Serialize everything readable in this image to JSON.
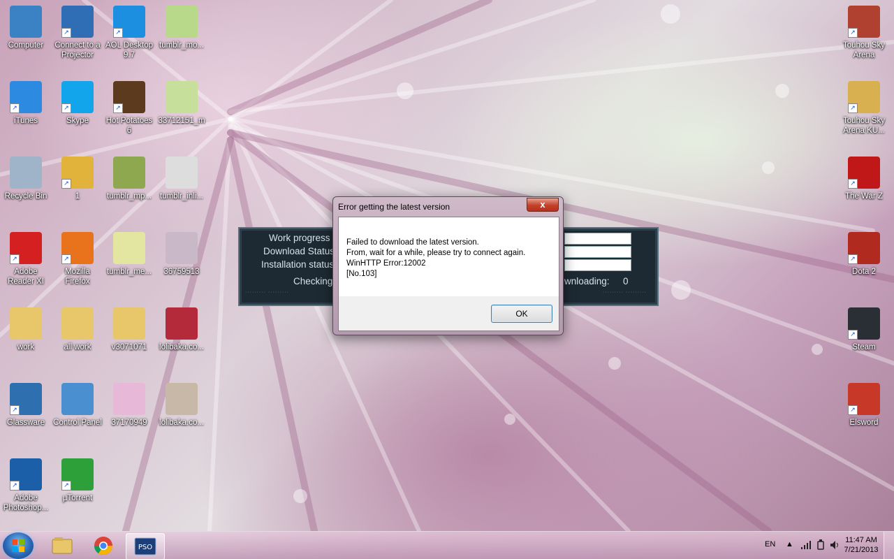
{
  "desktop_left": [
    {
      "label": "Computer",
      "icon": "computer-icon",
      "color": "#3b82c4"
    },
    {
      "label": "Connect to a Projector",
      "icon": "projector-icon",
      "color": "#2f6eb5"
    },
    {
      "label": "AOL Desktop 9.7",
      "icon": "aol-icon",
      "color": "#1d8fe0"
    },
    {
      "label": "tumblr_mo...",
      "icon": "image-thumbnail-icon",
      "color": "#b8d88a"
    },
    {
      "label": "iTunes",
      "icon": "itunes-icon",
      "color": "#2c8be0"
    },
    {
      "label": "Skype",
      "icon": "skype-icon",
      "color": "#12a5ec"
    },
    {
      "label": "Hot Potatoes 6",
      "icon": "hot-potatoes-icon",
      "color": "#5b3a1e"
    },
    {
      "label": "33712151_m",
      "icon": "image-thumbnail-icon",
      "color": "#c6e09c"
    },
    {
      "label": "Recycle Bin",
      "icon": "recycle-bin-icon",
      "color": "#9fb4c8"
    },
    {
      "label": "1",
      "icon": "chrome-icon",
      "color": "#e2b33a"
    },
    {
      "label": "tumblr_mp...",
      "icon": "image-thumbnail-icon",
      "color": "#8ea850"
    },
    {
      "label": "tumblr_inli...",
      "icon": "image-thumbnail-icon",
      "color": "#dddddd"
    },
    {
      "label": "Adobe Reader XI",
      "icon": "adobe-reader-icon",
      "color": "#d42020"
    },
    {
      "label": "Mozilla Firefox",
      "icon": "firefox-icon",
      "color": "#e8731c"
    },
    {
      "label": "tumblr_me...",
      "icon": "image-thumbnail-icon",
      "color": "#e2e6a0"
    },
    {
      "label": "36759513",
      "icon": "image-thumbnail-icon",
      "color": "#c8b8c8"
    },
    {
      "label": "work",
      "icon": "folder-icon",
      "color": "#e8c66a"
    },
    {
      "label": "all work",
      "icon": "folder-icon",
      "color": "#e8c66a"
    },
    {
      "label": "v3071071",
      "icon": "folder-icon",
      "color": "#e8c66a"
    },
    {
      "label": "lolibaka.co...",
      "icon": "image-thumbnail-icon",
      "color": "#b42a3a"
    },
    {
      "label": "Glassware",
      "icon": "glassware-icon",
      "color": "#2e6fb0"
    },
    {
      "label": "Control Panel",
      "icon": "control-panel-icon",
      "color": "#4a90d0"
    },
    {
      "label": "37170949",
      "icon": "image-thumbnail-icon",
      "color": "#e8b8d8"
    },
    {
      "label": "lolibaka.co...",
      "icon": "image-thumbnail-icon",
      "color": "#c8b8a8"
    },
    {
      "label": "Adobe Photoshop...",
      "icon": "photoshop-icon",
      "color": "#1a5fa8"
    },
    {
      "label": "µTorrent",
      "icon": "utorrent-icon",
      "color": "#2ea03a"
    }
  ],
  "desktop_right": [
    {
      "label": "Touhou Sky Arena",
      "icon": "touhou-sky-arena-icon",
      "color": "#b04030"
    },
    {
      "label": "Touhou Sky Arena KU...",
      "icon": "touhou-sky-arena-ku-icon",
      "color": "#d8b050"
    },
    {
      "label": "The War Z",
      "icon": "the-war-z-icon",
      "color": "#c01818"
    },
    {
      "label": "Dota 2",
      "icon": "dota2-icon",
      "color": "#b02a20"
    },
    {
      "label": "Steam",
      "icon": "steam-icon",
      "color": "#2a2f36"
    },
    {
      "label": "Elsword",
      "icon": "elsword-icon",
      "color": "#c83828"
    }
  ],
  "launcher": {
    "work_progress_label": "Work progress",
    "download_status_label": "Download Status",
    "installation_status_label": "Installation status",
    "checking_label": "Checking",
    "downloading_label": "wnloading:",
    "downloading_value": "0"
  },
  "dialog": {
    "title": "Error getting the latest version",
    "close_label": "x",
    "message_lines": [
      "Failed to download the latest version.",
      "From, wait for a while, please try to connect again.",
      "WinHTTP Error:12002",
      "[No.103]"
    ],
    "ok_label": "OK"
  },
  "taskbar": {
    "pinned": [
      {
        "icon": "windows-explorer-icon",
        "color": "#e8c66a"
      },
      {
        "icon": "chrome-icon",
        "color": "#e2b33a"
      },
      {
        "icon": "pso2-icon",
        "color": "#1c3f7a"
      }
    ],
    "language": "EN",
    "time": "11:47 AM",
    "date": "7/21/2013"
  }
}
